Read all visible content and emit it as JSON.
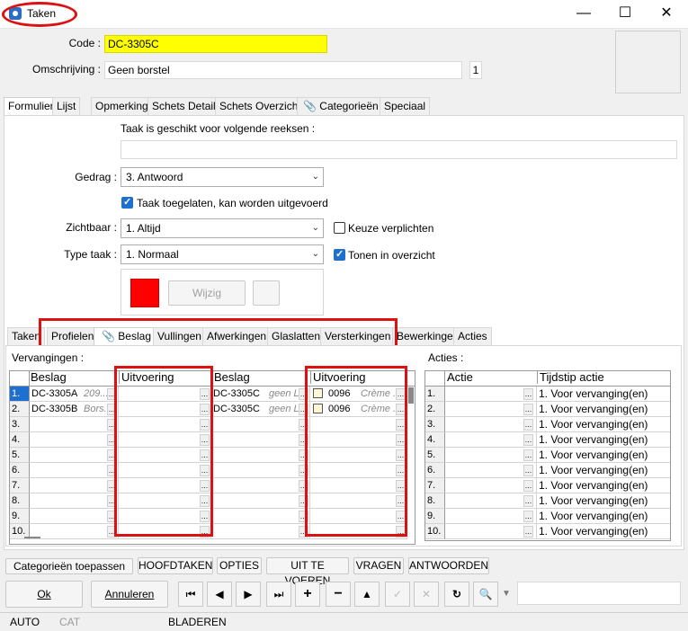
{
  "window": {
    "title": "Taken",
    "controls": {
      "minimize": "—",
      "maximize": "☐",
      "close": "✕"
    }
  },
  "header": {
    "code_label": "Code :",
    "code_value": "DC-3305C",
    "desc_label": "Omschrijving :",
    "desc_value": "Geen borstel",
    "desc_count": "1"
  },
  "main_tabs": [
    "Formulier",
    "Lijst",
    "Opmerking",
    "Schets Detail",
    "Schets Overzicht",
    "Categorieën",
    "Speciaal"
  ],
  "form": {
    "series_label": "Taak is geschikt voor volgende reeksen :",
    "series_value": "",
    "gedrag_label": "Gedrag :",
    "gedrag_value": "3.  Antwoord",
    "toegelaten_label": "Taak toegelaten, kan worden uitgevoerd",
    "zichtbaar_label": "Zichtbaar :",
    "zichtbaar_value": "1.  Altijd",
    "keuze_label": "Keuze verplichten",
    "typetaak_label": "Type taak :",
    "typetaak_value": "1.  Normaal",
    "tonen_label": "Tonen in overzicht",
    "color_value": "#ff0000",
    "wijzig_label": "Wijzig"
  },
  "sub_tabs": [
    "Taken",
    "Profielen",
    "Beslag",
    "Vullingen",
    "Afwerkingen",
    "Glaslatten",
    "Versterkingen",
    "Bewerkingen",
    "Acties"
  ],
  "vervangingen": {
    "label": "Vervangingen :",
    "headers": [
      "Beslag",
      "Uitvoering",
      "Beslag",
      "Uitvoering"
    ],
    "rows": [
      {
        "n": "1.",
        "b1": "DC-3305A",
        "b1i": "209...",
        "u1": "",
        "b2": "DC-3305C",
        "b2i": "geen L...",
        "u2": "0096",
        "u2i": "Crème ..."
      },
      {
        "n": "2.",
        "b1": "DC-3305B",
        "b1i": "Bors...",
        "u1": "",
        "b2": "DC-3305C",
        "b2i": "geen L...",
        "u2": "0096",
        "u2i": "Crème ..."
      },
      {
        "n": "3.",
        "b1": "",
        "b1i": "",
        "u1": "",
        "b2": "",
        "b2i": "",
        "u2": "",
        "u2i": ""
      },
      {
        "n": "4.",
        "b1": "",
        "b1i": "",
        "u1": "",
        "b2": "",
        "b2i": "",
        "u2": "",
        "u2i": ""
      },
      {
        "n": "5.",
        "b1": "",
        "b1i": "",
        "u1": "",
        "b2": "",
        "b2i": "",
        "u2": "",
        "u2i": ""
      },
      {
        "n": "6.",
        "b1": "",
        "b1i": "",
        "u1": "",
        "b2": "",
        "b2i": "",
        "u2": "",
        "u2i": ""
      },
      {
        "n": "7.",
        "b1": "",
        "b1i": "",
        "u1": "",
        "b2": "",
        "b2i": "",
        "u2": "",
        "u2i": ""
      },
      {
        "n": "8.",
        "b1": "",
        "b1i": "",
        "u1": "",
        "b2": "",
        "b2i": "",
        "u2": "",
        "u2i": ""
      },
      {
        "n": "9.",
        "b1": "",
        "b1i": "",
        "u1": "",
        "b2": "",
        "b2i": "",
        "u2": "",
        "u2i": ""
      },
      {
        "n": "10.",
        "b1": "",
        "b1i": "",
        "u1": "",
        "b2": "",
        "b2i": "",
        "u2": "",
        "u2i": ""
      }
    ]
  },
  "acties": {
    "label": "Acties :",
    "headers": [
      "Actie",
      "Tijdstip actie"
    ],
    "rows": [
      {
        "n": "1.",
        "a": "",
        "t": "1. Voor vervanging(en)"
      },
      {
        "n": "2.",
        "a": "",
        "t": "1. Voor vervanging(en)"
      },
      {
        "n": "3.",
        "a": "",
        "t": "1. Voor vervanging(en)"
      },
      {
        "n": "4.",
        "a": "",
        "t": "1. Voor vervanging(en)"
      },
      {
        "n": "5.",
        "a": "",
        "t": "1. Voor vervanging(en)"
      },
      {
        "n": "6.",
        "a": "",
        "t": "1. Voor vervanging(en)"
      },
      {
        "n": "7.",
        "a": "",
        "t": "1. Voor vervanging(en)"
      },
      {
        "n": "8.",
        "a": "",
        "t": "1. Voor vervanging(en)"
      },
      {
        "n": "9.",
        "a": "",
        "t": "1. Voor vervanging(en)"
      },
      {
        "n": "10.",
        "a": "",
        "t": "1. Voor vervanging(en)"
      }
    ]
  },
  "bottom_buttons": [
    "Categorieën toepassen",
    "HOOFDTAKEN",
    "OPTIES",
    "UIT TE VOEREN",
    "VRAGEN",
    "ANTWOORDEN"
  ],
  "actions": {
    "ok": "Ok",
    "cancel": "Annuleren"
  },
  "nav_icons": [
    "first-icon",
    "prev-icon",
    "next-icon",
    "last-icon",
    "add-icon",
    "remove-icon",
    "up-icon",
    "confirm-icon",
    "cancel-icon",
    "refresh-icon",
    "search-icon",
    "dropdown-icon"
  ],
  "status": {
    "auto": "AUTO",
    "cat": "CAT",
    "mode": "BLADEREN"
  },
  "colors": {
    "highlight": "#ffff00",
    "accent": "#1f6fd0",
    "annotation": "#dd1111"
  }
}
